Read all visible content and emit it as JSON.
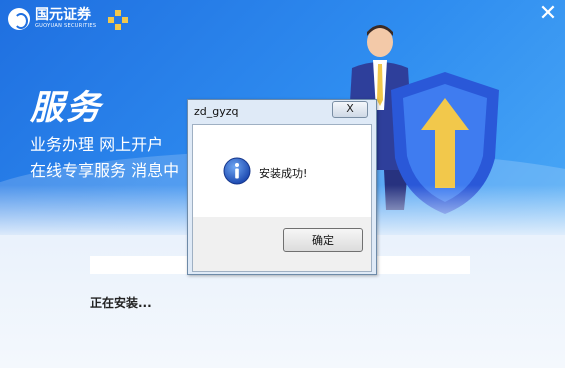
{
  "brand": {
    "name_cn": "国元证券",
    "name_en": "GUOYUAN SECURITIES"
  },
  "banner": {
    "headline": "服务",
    "line1": "业务办理  网上开户",
    "line2": "在线专享服务  消息中"
  },
  "installer": {
    "status_text": "正在安装..."
  },
  "dialog": {
    "title": "zd_gyzq",
    "close_label": "X",
    "message": "安装成功!",
    "ok_label": "确定"
  },
  "colors": {
    "banner_blue": "#1f6fe0",
    "accent_gold": "#f2c84b"
  },
  "icons": {
    "window_close": "close-icon",
    "dialog_info": "info-icon"
  }
}
